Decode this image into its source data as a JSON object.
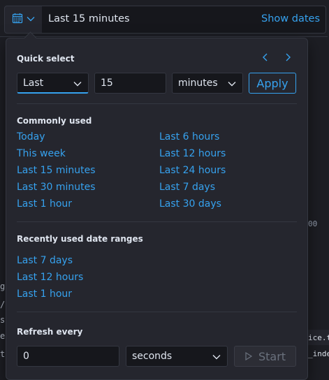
{
  "topbar": {
    "date_display": "Last 15 minutes",
    "show_dates_label": "Show dates"
  },
  "quick_select": {
    "title": "Quick select",
    "tense": "Last",
    "value": "15",
    "unit": "minutes",
    "apply_label": "Apply"
  },
  "commonly_used": {
    "title": "Commonly used",
    "left": [
      "Today",
      "This week",
      "Last 15 minutes",
      "Last 30 minutes",
      "Last 1 hour"
    ],
    "right": [
      "Last 6 hours",
      "Last 12 hours",
      "Last 24 hours",
      "Last 7 days",
      "Last 30 days"
    ]
  },
  "recently_used": {
    "title": "Recently used date ranges",
    "items": [
      "Last 7 days",
      "Last 12 hours",
      "Last 1 hour"
    ]
  },
  "refresh": {
    "title": "Refresh every",
    "value": "0",
    "unit": "seconds",
    "start_label": "Start"
  },
  "background": {
    "right_text_1": "00",
    "right_text_2": "ice.t",
    "right_text_3": "_inde",
    "left_text": [
      "g:",
      "/p",
      "s",
      "e",
      "t"
    ]
  },
  "colors": {
    "accent": "#36a2ef",
    "panel": "#25262e",
    "border": "#343741"
  }
}
